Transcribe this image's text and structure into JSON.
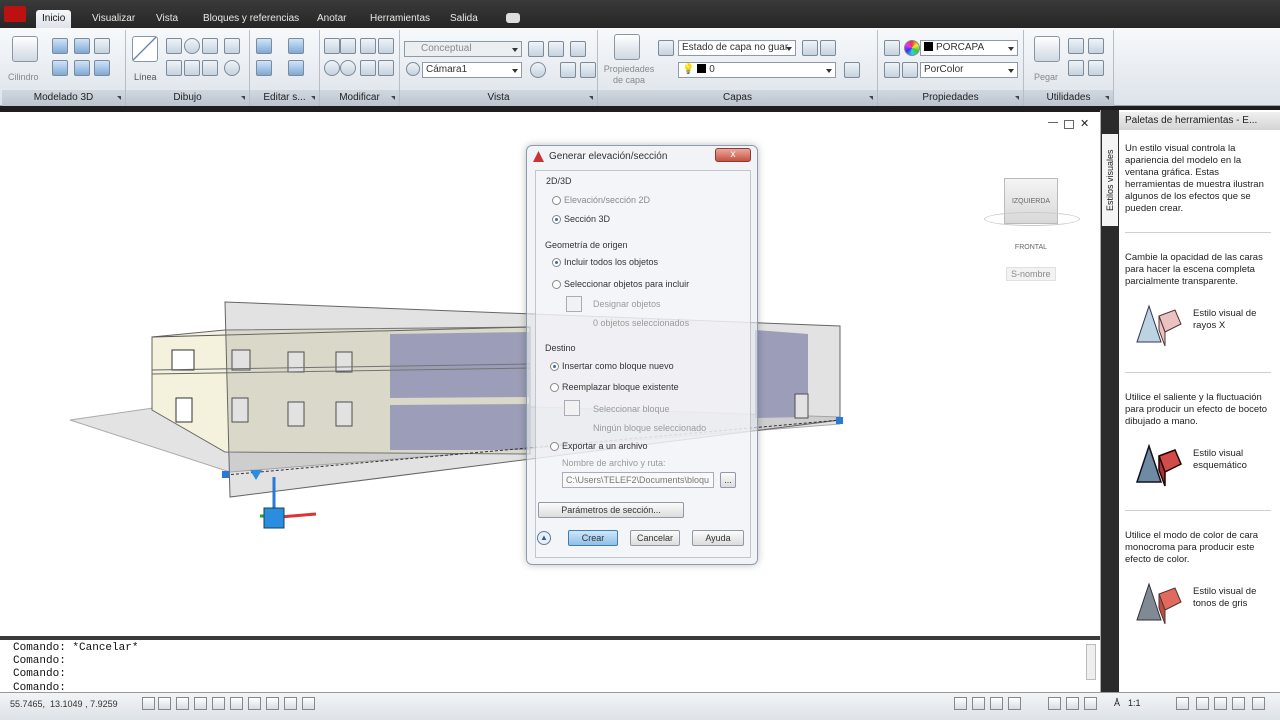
{
  "tabs": [
    "Inicio",
    "Visualizar",
    "Vista",
    "Bloques y referencias",
    "Anotar",
    "Herramientas",
    "Salida"
  ],
  "ribbon": {
    "panels": [
      "Modelado 3D",
      "Dibujo",
      "Editar s...",
      "Modificar",
      "Vista",
      "Capas",
      "Propiedades",
      "Utilidades"
    ],
    "cylinder_label": "Cilindro",
    "line_label": "Línea",
    "visual_style": "Conceptual",
    "camera": "Cámara1",
    "layer_props_label": "Propiedades\nde capa",
    "layer_state": "Estado de capa no guar",
    "layer_current": "0",
    "color": "PORCAPA",
    "plot_style": "PorColor",
    "paste_label": "Pegar"
  },
  "viewport": {
    "viewcube_text": "IZQUIERDA  FRONTAL",
    "ucs_label": "S-nombre"
  },
  "dialog": {
    "title": "Generar elevación/sección",
    "close": "x",
    "group_2d3d": "2D/3D",
    "opt_elev2d": "Elevación/sección 2D",
    "opt_sec3d": "Sección 3D",
    "group_geom": "Geometría de origen",
    "opt_incl_all": "Incluir todos los objetos",
    "opt_sel_objs": "Seleccionar objetos para incluir",
    "designate": "Designar objetos",
    "objs_selected": "0 objetos seleccionados",
    "group_dest": "Destino",
    "opt_insert_block": "Insertar como bloque nuevo",
    "opt_replace_block": "Reemplazar bloque existente",
    "select_block": "Seleccionar bloque",
    "no_block": "Ningún bloque seleccionado",
    "opt_export": "Exportar a un archivo",
    "file_label": "Nombre de archivo y ruta:",
    "file_path": "C:\\Users\\TELEF2\\Documents\\bloqu",
    "browse": "...",
    "section_params": "Parámetros de sección...",
    "create": "Crear",
    "cancel": "Cancelar",
    "help": "Ayuda"
  },
  "palette": {
    "title": "Paletas de herramientas - E...",
    "tab": "Estilos visuales",
    "intro": "Un estilo visual controla la apariencia del modelo en la ventana gráfica. Estas herramientas de muestra ilustran algunos de los efectos que se pueden crear.",
    "desc_xray": "Cambie la opacidad de las caras para hacer la escena completa parcialmente transparente.",
    "item_xray": "Estilo visual de rayos X",
    "desc_sketch": "Utilice el saliente y la fluctuación para producir un efecto de boceto dibujado a mano.",
    "item_sketch": "Estilo visual esquemático",
    "desc_gray": "Utilice el modo de color de cara monocroma para producir este efecto de color.",
    "item_gray": "Estilo visual de tonos de gris"
  },
  "command": {
    "lines": [
      "Comando: *Cancelar*",
      "Comando:",
      "Comando:"
    ],
    "prompt": "Comando:"
  },
  "status": {
    "coords": "55.7465,  13.1049 , 7.9259",
    "scale": "1:1"
  }
}
